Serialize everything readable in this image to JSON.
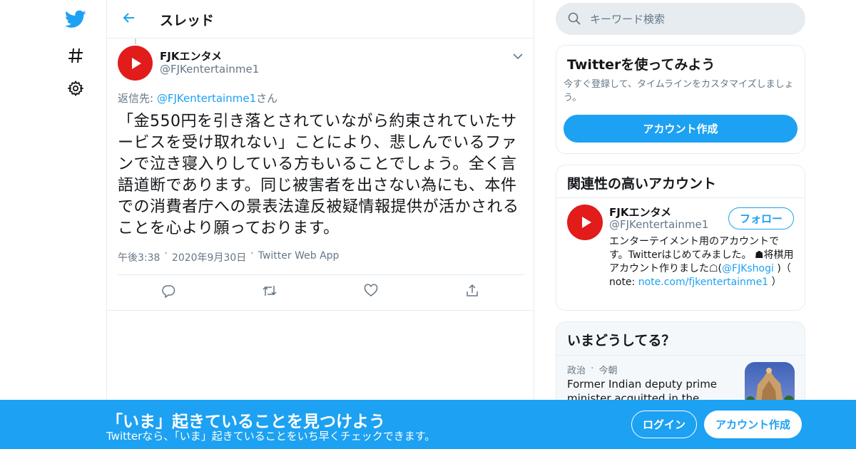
{
  "colors": {
    "accent": "#1da1f2",
    "text": "#14171a",
    "muted": "#657786",
    "border": "#e6ecf0",
    "avatar_bg": "#e21b1b"
  },
  "nav": {
    "items": [
      {
        "icon": "twitter-bird-icon"
      },
      {
        "icon": "hashtag-icon"
      },
      {
        "icon": "gear-icon"
      }
    ]
  },
  "header": {
    "back_icon": "arrow-left-icon",
    "title": "スレッド"
  },
  "tweet": {
    "author_name": "FJKエンタメ",
    "author_handle": "@FJKentertainme1",
    "reply_prefix": "返信先: ",
    "reply_mention": "@FJKentertainme1",
    "reply_suffix": "さん",
    "text": "「金550円を引き落とされていながら約束されていたサービスを受け取れない」ことにより、悲しんでいるファンで泣き寝入りしている方もいることでしょう。全く言語道断であります。同じ被害者を出さない為にも、本件での消費者庁への景表法違反被疑情報提供が活かされることを心より願っております。",
    "time": "午後3:38",
    "date": "2020年9月30日",
    "source": "Twitter Web App",
    "separator": "·",
    "actions": [
      "reply-icon",
      "retweet-icon",
      "like-icon",
      "share-icon"
    ]
  },
  "search": {
    "placeholder": "キーワード検索"
  },
  "signup_card": {
    "title": "Twitterを使ってみよう",
    "description": "今すぐ登録して、タイムラインをカスタマイズしましょう。",
    "button": "アカウント作成"
  },
  "related": {
    "title": "関連性の高いアカウント",
    "account": {
      "name": "FJKエンタメ",
      "handle": "@FJKentertainme1",
      "follow_label": "フォロー",
      "bio_1": "エンターテイメント用のアカウントです。Twitterはじめてみました。 ☗将棋用アカウント作りました☖(",
      "bio_link_1": "@FJKshogi",
      "bio_2": " )（ note: ",
      "bio_link_2": "note.com/fjkentertainme1",
      "bio_3": " ）"
    }
  },
  "trends": {
    "title": "いまどうしてる？",
    "item": {
      "category": "政治",
      "separator": "·",
      "time": "今朝",
      "headline": "Former Indian deputy prime minister acquitted in the demolition"
    }
  },
  "bottom_bar": {
    "title": "「いま」起きていることを見つけよう",
    "subtitle": "Twitterなら、「いま」起きていることをいち早くチェックできます。",
    "login": "ログイン",
    "signup": "アカウント作成"
  }
}
